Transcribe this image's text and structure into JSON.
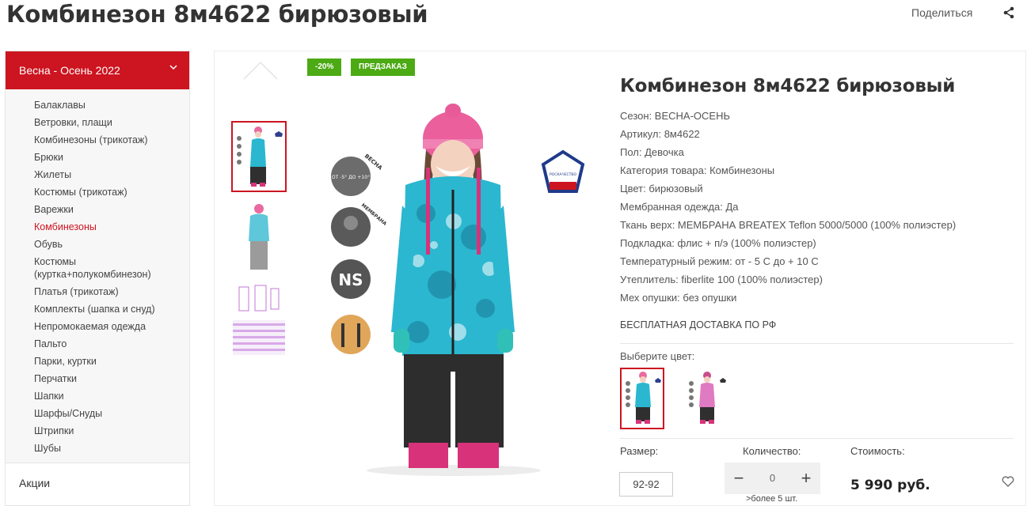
{
  "page": {
    "title": "Комбинезон 8м4622 бирюзовый",
    "share_label": "Поделиться"
  },
  "sidebar": {
    "header": "Весна - Осень 2022",
    "items": [
      {
        "label": "Балаклавы"
      },
      {
        "label": "Ветровки, плащи"
      },
      {
        "label": "Комбинезоны (трикотаж)"
      },
      {
        "label": "Брюки"
      },
      {
        "label": "Жилеты"
      },
      {
        "label": "Костюмы (трикотаж)"
      },
      {
        "label": "Варежки"
      },
      {
        "label": "Комбинезоны",
        "active": true
      },
      {
        "label": "Обувь"
      },
      {
        "label": "Костюмы\n(куртка+полукомбинезон)"
      },
      {
        "label": "Платья (трикотаж)"
      },
      {
        "label": "Комплекты (шапка и снуд)"
      },
      {
        "label": "Непромокаемая одежда"
      },
      {
        "label": "Пальто"
      },
      {
        "label": "Парки, куртки"
      },
      {
        "label": "Перчатки"
      },
      {
        "label": "Шапки"
      },
      {
        "label": "Шарфы/Снуды"
      },
      {
        "label": "Штрипки"
      },
      {
        "label": "Шубы"
      }
    ],
    "bottom": "Акции"
  },
  "product": {
    "badges": [
      "-20%",
      "ПРЕДЗАКАЗ"
    ],
    "title": "Комбинезон 8м4622 бирюзовый",
    "props": [
      "Сезон: ВЕСНА-ОСЕНЬ",
      "Артикул: 8м4622",
      "Пол: Девочка",
      "Категория товара: Комбинезоны",
      "Цвет: бирюзовый",
      "Мембранная одежда: Да",
      "Ткань верх: МЕМБРАНА BREATEX Teflon 5000/5000 (100% полиэстер)",
      "Подкладка: флис + п/э (100% полиэстер)",
      "Температурный режим: от - 5 С до + 10 С",
      "Утеплитель: fiberlite 100 (100% полиэстер)",
      "Мех опушки: без опушки"
    ],
    "free_delivery": "БЕСПЛАТНАЯ ДОСТАВКА ПО РФ",
    "choose_color": "Выберите цвет:",
    "size_label": "Размер:",
    "size_value": "92-92",
    "qty_label": "Количество:",
    "qty_value": "0",
    "qty_minus": "−",
    "qty_plus": "+",
    "stock": ">более 5 шт.",
    "price_label": "Стоимость:",
    "price": "5 990 руб."
  },
  "image_labels": {
    "season": "ВЕСНА",
    "temp": "ОТ -5° ДО +10°",
    "membrane": "МЕМБРАНА",
    "reflect": "СВЕТООТРАЖАЮЩИЕ ЭЛЕМЕНТЫ",
    "ns": "NS",
    "braces": "ВНУТРЕННИЕ БРЕТЕЛИ",
    "roskachestvo": "РОСКАЧЕСТВО"
  },
  "colors": {
    "accent": "#cc1520",
    "badge": "#4caa14",
    "turquoise": "#2bb7d0",
    "pink": "#e83f8c"
  }
}
